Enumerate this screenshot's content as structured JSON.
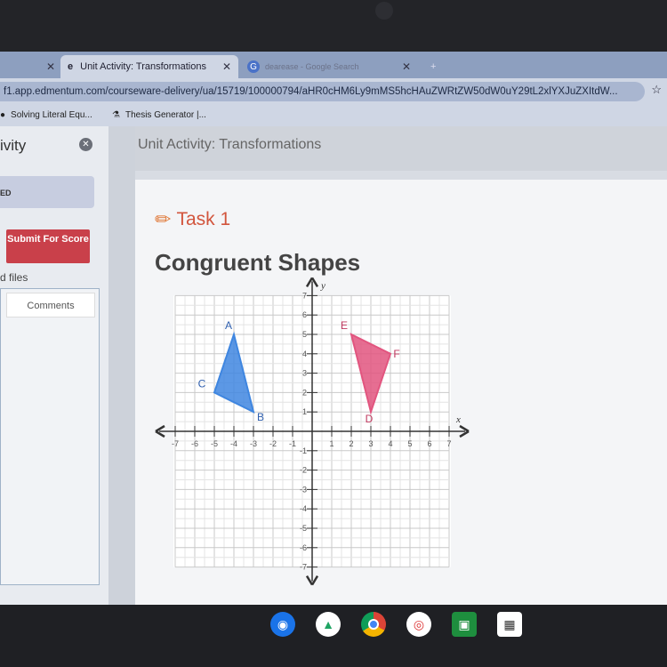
{
  "browser": {
    "tabs": [
      {
        "label": "Unit Activity: Transformations",
        "active": true
      },
      {
        "label": "dearease - Google Search",
        "active": false
      }
    ],
    "new_tab": "+",
    "url": "f1.app.edmentum.com/courseware-delivery/ua/15719/100000794/aHR0cHM6Ly9mMS5hcHAuZWRtZW50dW0uY29tL2xlYXJuZXItdW...",
    "bookmarks": [
      {
        "label": "Solving Literal Equ..."
      },
      {
        "label": "Thesis Generator |..."
      }
    ]
  },
  "sidebar": {
    "title": "ivity",
    "status": "ED",
    "submit": "Submit For Score",
    "files": "d files",
    "comments_tab": "Comments"
  },
  "main": {
    "header": "Unit Activity: Transformations",
    "task": "Task 1",
    "title": "Congruent Shapes"
  },
  "chart_data": {
    "type": "scatter",
    "xlabel": "x",
    "ylabel": "y",
    "xlim": [
      -7,
      7
    ],
    "ylim": [
      -7,
      7
    ],
    "grid": true,
    "xticks": [
      -7,
      -6,
      -5,
      -4,
      -3,
      -2,
      -1,
      1,
      2,
      3,
      4,
      5,
      6,
      7
    ],
    "yticks": [
      -7,
      -6,
      -5,
      -4,
      -3,
      -2,
      -1,
      1,
      2,
      3,
      4,
      5,
      6,
      7
    ],
    "shapes": [
      {
        "type": "triangle",
        "color": "#3f86e0",
        "points": [
          {
            "label": "A",
            "x": -4,
            "y": 5
          },
          {
            "label": "B",
            "x": -3,
            "y": 1
          },
          {
            "label": "C",
            "x": -5,
            "y": 2
          }
        ]
      },
      {
        "type": "triangle",
        "color": "#e2557f",
        "points": [
          {
            "label": "E",
            "x": 2,
            "y": 5
          },
          {
            "label": "F",
            "x": 4,
            "y": 4
          },
          {
            "label": "D",
            "x": 3,
            "y": 1
          }
        ]
      }
    ]
  },
  "taskbar": {
    "icons": [
      "camera-icon",
      "drive-icon",
      "chrome-icon",
      "record-icon",
      "classroom-icon",
      "qr-icon"
    ]
  }
}
